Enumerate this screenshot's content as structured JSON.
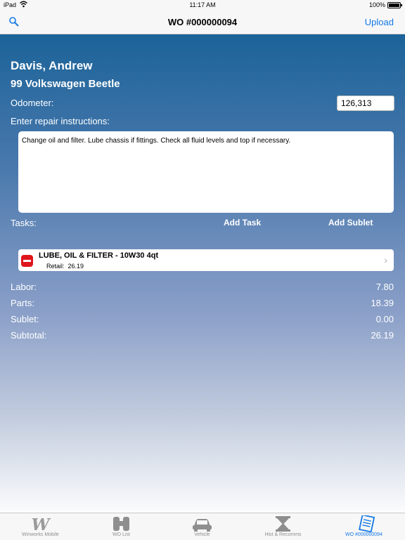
{
  "status_bar": {
    "carrier": "iPad",
    "time": "11:17 AM",
    "battery": "100%"
  },
  "nav_bar": {
    "title": "WO #000000094",
    "upload_label": "Upload",
    "search_icon": "search-icon"
  },
  "customer": {
    "name": "Davis, Andrew",
    "vehicle": "99 Volkswagen Beetle",
    "odometer_label": "Odometer:",
    "odometer_value": "126,313"
  },
  "repair": {
    "label": "Enter repair instructions:",
    "text": "Change oil and filter. Lube chassis if fittings. Check all fluid levels and top if necessary."
  },
  "tasks": {
    "label": "Tasks:",
    "add_task_label": "Add Task",
    "add_sublet_label": "Add Sublet",
    "items": [
      {
        "title": "LUBE, OIL & FILTER - 10W30 4qt",
        "retail_label": "Retail:",
        "retail_value": "26.19"
      }
    ]
  },
  "summary": {
    "labor_label": "Labor:",
    "labor_value": "7.80",
    "parts_label": "Parts:",
    "parts_value": "18.39",
    "sublet_label": "Sublet:",
    "sublet_value": "0.00",
    "subtotal_label": "Subtotal:",
    "subtotal_value": "26.19"
  },
  "tab_bar": {
    "tabs": [
      {
        "label": "Winworks Mobile",
        "icon": "winworks-logo-icon"
      },
      {
        "label": "WO List",
        "icon": "binoculars-icon"
      },
      {
        "label": "Vehicle",
        "icon": "car-icon"
      },
      {
        "label": "Hist & Recomms",
        "icon": "hourglass-icon"
      },
      {
        "label": "WO #000000094",
        "icon": "work-order-icon"
      }
    ],
    "active_index": 4
  },
  "colors": {
    "accent": "#1478e6",
    "delete": "#e0161d"
  }
}
